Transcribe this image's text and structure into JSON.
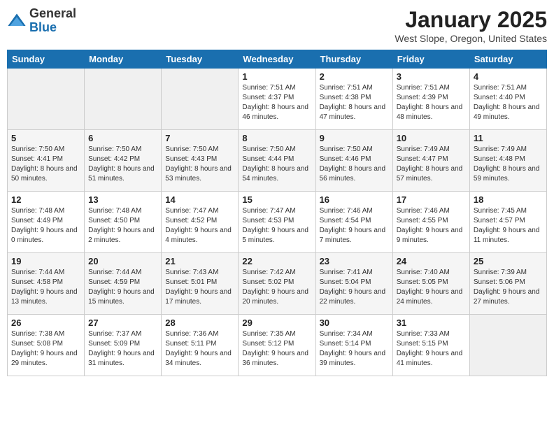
{
  "logo": {
    "general": "General",
    "blue": "Blue"
  },
  "title": "January 2025",
  "subtitle": "West Slope, Oregon, United States",
  "days_of_week": [
    "Sunday",
    "Monday",
    "Tuesday",
    "Wednesday",
    "Thursday",
    "Friday",
    "Saturday"
  ],
  "weeks": [
    [
      {
        "num": "",
        "info": ""
      },
      {
        "num": "",
        "info": ""
      },
      {
        "num": "",
        "info": ""
      },
      {
        "num": "1",
        "info": "Sunrise: 7:51 AM\nSunset: 4:37 PM\nDaylight: 8 hours and 46 minutes."
      },
      {
        "num": "2",
        "info": "Sunrise: 7:51 AM\nSunset: 4:38 PM\nDaylight: 8 hours and 47 minutes."
      },
      {
        "num": "3",
        "info": "Sunrise: 7:51 AM\nSunset: 4:39 PM\nDaylight: 8 hours and 48 minutes."
      },
      {
        "num": "4",
        "info": "Sunrise: 7:51 AM\nSunset: 4:40 PM\nDaylight: 8 hours and 49 minutes."
      }
    ],
    [
      {
        "num": "5",
        "info": "Sunrise: 7:50 AM\nSunset: 4:41 PM\nDaylight: 8 hours and 50 minutes."
      },
      {
        "num": "6",
        "info": "Sunrise: 7:50 AM\nSunset: 4:42 PM\nDaylight: 8 hours and 51 minutes."
      },
      {
        "num": "7",
        "info": "Sunrise: 7:50 AM\nSunset: 4:43 PM\nDaylight: 8 hours and 53 minutes."
      },
      {
        "num": "8",
        "info": "Sunrise: 7:50 AM\nSunset: 4:44 PM\nDaylight: 8 hours and 54 minutes."
      },
      {
        "num": "9",
        "info": "Sunrise: 7:50 AM\nSunset: 4:46 PM\nDaylight: 8 hours and 56 minutes."
      },
      {
        "num": "10",
        "info": "Sunrise: 7:49 AM\nSunset: 4:47 PM\nDaylight: 8 hours and 57 minutes."
      },
      {
        "num": "11",
        "info": "Sunrise: 7:49 AM\nSunset: 4:48 PM\nDaylight: 8 hours and 59 minutes."
      }
    ],
    [
      {
        "num": "12",
        "info": "Sunrise: 7:48 AM\nSunset: 4:49 PM\nDaylight: 9 hours and 0 minutes."
      },
      {
        "num": "13",
        "info": "Sunrise: 7:48 AM\nSunset: 4:50 PM\nDaylight: 9 hours and 2 minutes."
      },
      {
        "num": "14",
        "info": "Sunrise: 7:47 AM\nSunset: 4:52 PM\nDaylight: 9 hours and 4 minutes."
      },
      {
        "num": "15",
        "info": "Sunrise: 7:47 AM\nSunset: 4:53 PM\nDaylight: 9 hours and 5 minutes."
      },
      {
        "num": "16",
        "info": "Sunrise: 7:46 AM\nSunset: 4:54 PM\nDaylight: 9 hours and 7 minutes."
      },
      {
        "num": "17",
        "info": "Sunrise: 7:46 AM\nSunset: 4:55 PM\nDaylight: 9 hours and 9 minutes."
      },
      {
        "num": "18",
        "info": "Sunrise: 7:45 AM\nSunset: 4:57 PM\nDaylight: 9 hours and 11 minutes."
      }
    ],
    [
      {
        "num": "19",
        "info": "Sunrise: 7:44 AM\nSunset: 4:58 PM\nDaylight: 9 hours and 13 minutes."
      },
      {
        "num": "20",
        "info": "Sunrise: 7:44 AM\nSunset: 4:59 PM\nDaylight: 9 hours and 15 minutes."
      },
      {
        "num": "21",
        "info": "Sunrise: 7:43 AM\nSunset: 5:01 PM\nDaylight: 9 hours and 17 minutes."
      },
      {
        "num": "22",
        "info": "Sunrise: 7:42 AM\nSunset: 5:02 PM\nDaylight: 9 hours and 20 minutes."
      },
      {
        "num": "23",
        "info": "Sunrise: 7:41 AM\nSunset: 5:04 PM\nDaylight: 9 hours and 22 minutes."
      },
      {
        "num": "24",
        "info": "Sunrise: 7:40 AM\nSunset: 5:05 PM\nDaylight: 9 hours and 24 minutes."
      },
      {
        "num": "25",
        "info": "Sunrise: 7:39 AM\nSunset: 5:06 PM\nDaylight: 9 hours and 27 minutes."
      }
    ],
    [
      {
        "num": "26",
        "info": "Sunrise: 7:38 AM\nSunset: 5:08 PM\nDaylight: 9 hours and 29 minutes."
      },
      {
        "num": "27",
        "info": "Sunrise: 7:37 AM\nSunset: 5:09 PM\nDaylight: 9 hours and 31 minutes."
      },
      {
        "num": "28",
        "info": "Sunrise: 7:36 AM\nSunset: 5:11 PM\nDaylight: 9 hours and 34 minutes."
      },
      {
        "num": "29",
        "info": "Sunrise: 7:35 AM\nSunset: 5:12 PM\nDaylight: 9 hours and 36 minutes."
      },
      {
        "num": "30",
        "info": "Sunrise: 7:34 AM\nSunset: 5:14 PM\nDaylight: 9 hours and 39 minutes."
      },
      {
        "num": "31",
        "info": "Sunrise: 7:33 AM\nSunset: 5:15 PM\nDaylight: 9 hours and 41 minutes."
      },
      {
        "num": "",
        "info": ""
      }
    ]
  ]
}
